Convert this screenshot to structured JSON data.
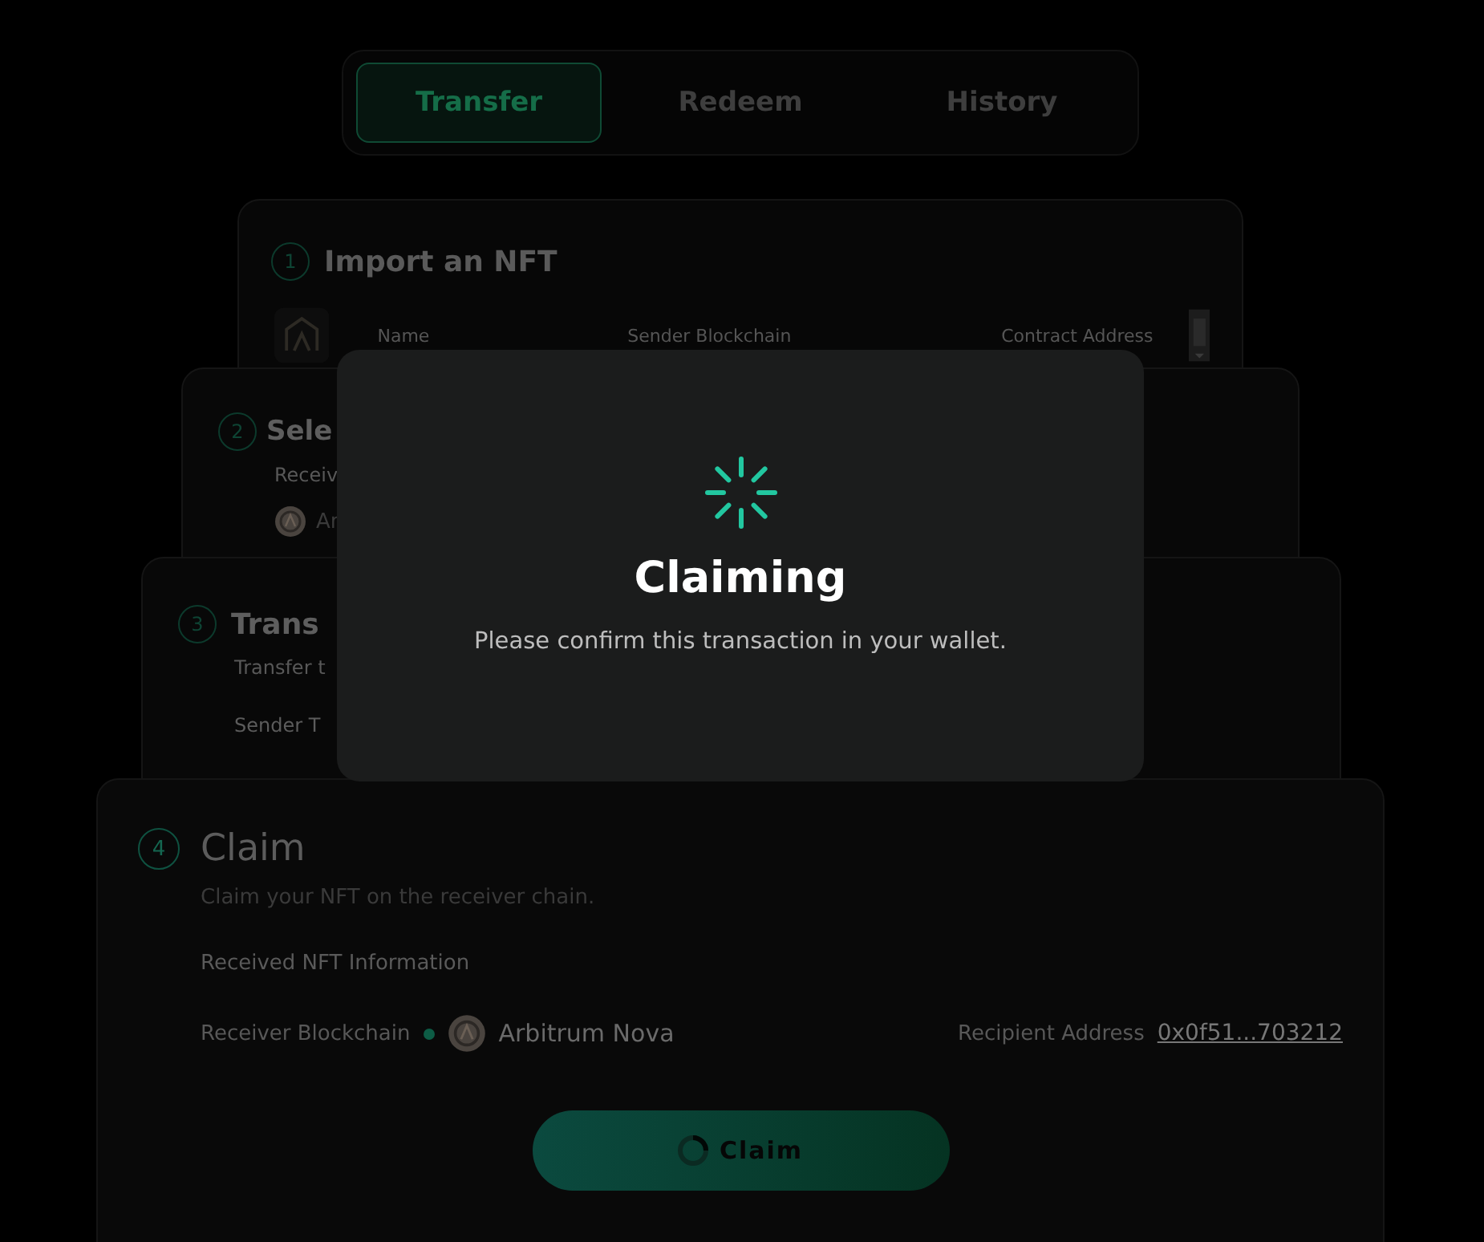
{
  "tabs": [
    {
      "label": "Transfer",
      "selected": true
    },
    {
      "label": "Redeem",
      "selected": false
    },
    {
      "label": "History",
      "selected": false
    }
  ],
  "steps": [
    {
      "kind": "import",
      "number": "1",
      "title": "Import an NFT",
      "columns": [
        "Name",
        "Sender Blockchain",
        "Contract Address"
      ]
    },
    {
      "kind": "select",
      "number": "2",
      "title": "Sele",
      "subtitle": "Receiv",
      "chain": "Ar"
    },
    {
      "kind": "transfer",
      "number": "3",
      "title": "Trans",
      "subtitle": "Transfer t",
      "section": "Sender T"
    },
    {
      "kind": "claim",
      "number": "4",
      "title": "Claim",
      "subtitle": "Claim your NFT on the receiver chain.",
      "section": "Received NFT Information",
      "receiver_label": "Receiver Blockchain",
      "chain": "Arbitrum Nova",
      "recipient_label": "Recipient Address",
      "recipient": "0x0f51...703212",
      "button": "Claim"
    }
  ],
  "modal": {
    "title": "Claiming",
    "message": "Please confirm this transaction in your wallet."
  }
}
